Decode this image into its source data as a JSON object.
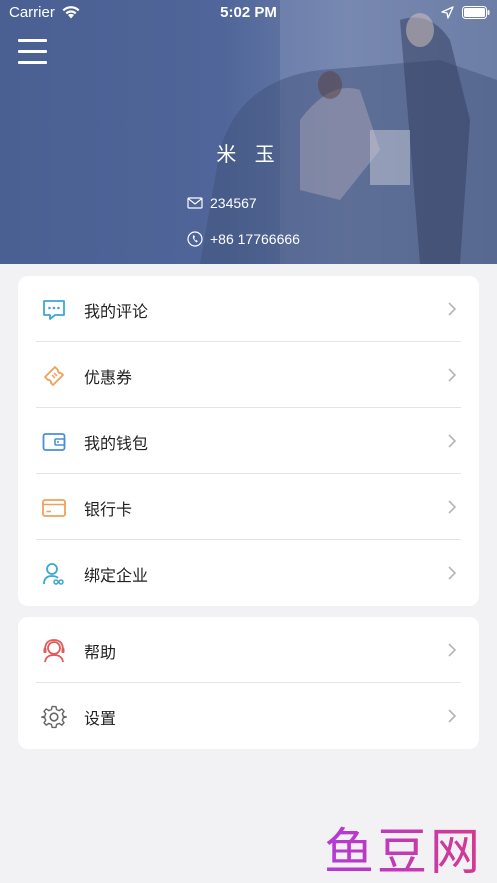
{
  "status_bar": {
    "carrier": "Carrier",
    "time": "5:02 PM"
  },
  "header": {
    "background_color": "#4e6396",
    "user_name": "米 玉",
    "email": "234567",
    "phone": "+86 17766666"
  },
  "menu_groups": [
    {
      "items": [
        {
          "label": "我的评论",
          "icon": "comment-icon",
          "icon_color": "#3ba7d8"
        },
        {
          "label": "优惠券",
          "icon": "coupon-icon",
          "icon_color": "#f0a05a"
        },
        {
          "label": "我的钱包",
          "icon": "wallet-icon",
          "icon_color": "#4a8fd8"
        },
        {
          "label": "银行卡",
          "icon": "bank-card-icon",
          "icon_color": "#f0a05a"
        },
        {
          "label": "绑定企业",
          "icon": "bind-company-icon",
          "icon_color": "#3ba7d8"
        }
      ]
    },
    {
      "items": [
        {
          "label": "帮助",
          "icon": "help-icon",
          "icon_color": "#e05a5a"
        },
        {
          "label": "设置",
          "icon": "settings-icon",
          "icon_color": "#666666"
        }
      ]
    }
  ],
  "watermark": "鱼豆网",
  "colors": {
    "page_background": "#f2f2f4",
    "card_background": "#ffffff",
    "chevron": "#b5b5b8"
  }
}
